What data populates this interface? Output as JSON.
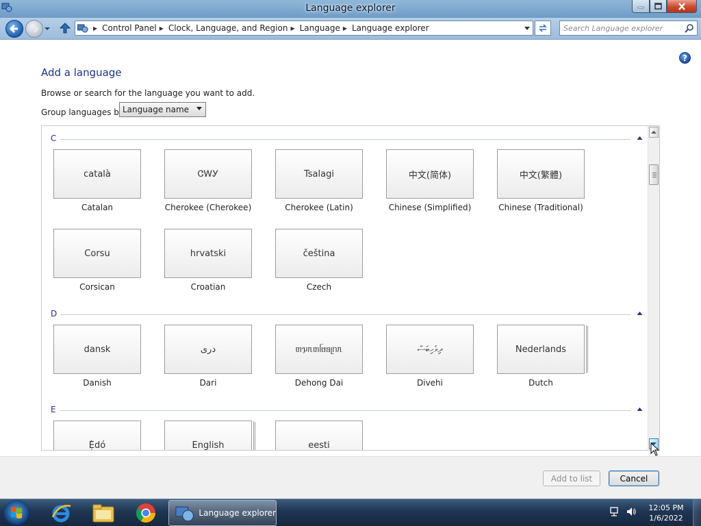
{
  "window": {
    "title": "Language explorer",
    "controls": {
      "minimize": "minimize-icon",
      "maximize": "maximize-icon",
      "close": "close-icon"
    }
  },
  "address": {
    "breadcrumbs": [
      "Control Panel",
      "Clock, Language, and Region",
      "Language",
      "Language explorer"
    ],
    "search_placeholder": "Search Language explorer"
  },
  "main": {
    "heading": "Add a language",
    "description": "Browse or search for the language you want to add.",
    "group_label": "Group languages by:",
    "group_value": "Language name",
    "sections": [
      {
        "letter": "C",
        "languages": [
          {
            "native": "català",
            "name": "Catalan"
          },
          {
            "native": "ᏣᎳᎩ",
            "name": "Cherokee (Cherokee)"
          },
          {
            "native": "Tsalagi",
            "name": "Cherokee (Latin)"
          },
          {
            "native": "中文(简体)",
            "name": "Chinese (Simplified)"
          },
          {
            "native": "中文(繁體)",
            "name": "Chinese (Traditional)"
          },
          {
            "native": "Corsu",
            "name": "Corsican"
          },
          {
            "native": "hrvatski",
            "name": "Croatian"
          },
          {
            "native": "čeština",
            "name": "Czech"
          }
        ]
      },
      {
        "letter": "D",
        "languages": [
          {
            "native": "dansk",
            "name": "Danish"
          },
          {
            "native": "درى",
            "name": "Dari"
          },
          {
            "native": "ᥖᥭᥰᥖᥬᥳᥑᥨᥒᥰ",
            "name": "Dehong Dai"
          },
          {
            "native": "ދިވެހިބަސް",
            "name": "Divehi"
          },
          {
            "native": "Nederlands",
            "name": "Dutch"
          }
        ]
      },
      {
        "letter": "E",
        "languages": [
          {
            "native": "Ẹ̀dó",
            "name": ""
          },
          {
            "native": "English",
            "name": ""
          },
          {
            "native": "eesti",
            "name": ""
          }
        ]
      }
    ]
  },
  "buttons": {
    "add": "Add to list",
    "cancel": "Cancel"
  },
  "taskbar": {
    "task_label": "Language explorer",
    "time": "12:05 PM",
    "date": "1/6/2022"
  },
  "colors": {
    "accent": "#1e3287",
    "taskbar": "#1f3552",
    "titlebar": "#7fa9d0"
  }
}
